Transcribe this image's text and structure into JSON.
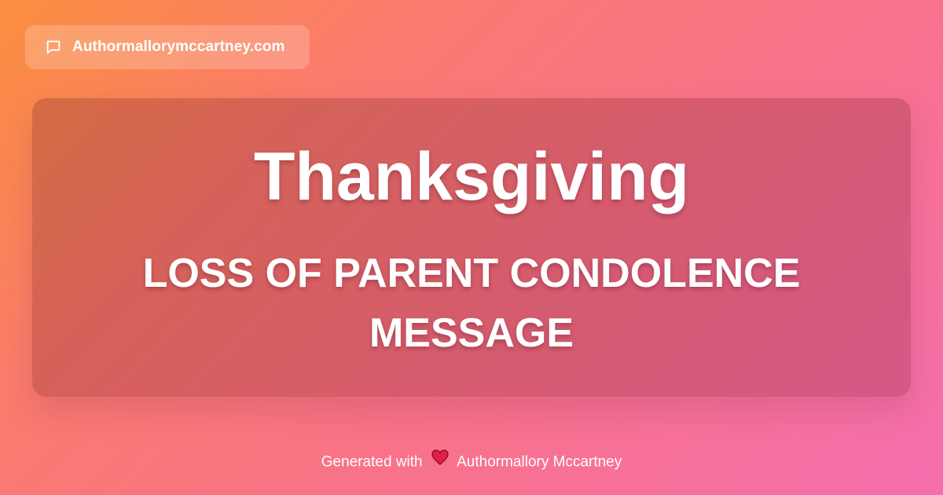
{
  "site": {
    "domain": "Authormallorymccartney.com",
    "icon": "chat-bubble-icon"
  },
  "card": {
    "title": "Thanksgiving",
    "subtitle": "LOSS OF PARENT CONDOLENCE MESSAGE"
  },
  "footer": {
    "prefix": "Generated with",
    "icon": "heart-icon",
    "author": "Authormallory Mccartney"
  },
  "colors": {
    "gradient_start": "#fb8f3f",
    "gradient_mid": "#f9728a",
    "gradient_end": "#f46fae",
    "heart": "#e11d48",
    "text": "#ffffff"
  }
}
